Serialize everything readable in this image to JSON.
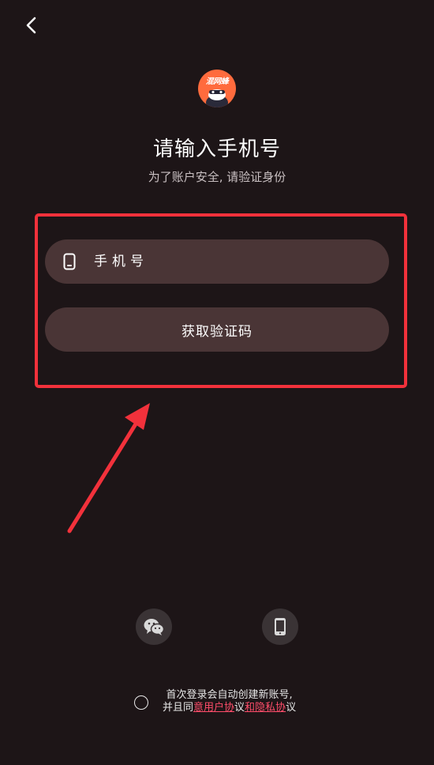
{
  "header": {
    "back_icon": "chevron-left-icon"
  },
  "logo": {
    "text": "混网蜂",
    "icon": "app-logo"
  },
  "title": "请输入手机号",
  "subtitle": "为了账户安全, 请验证身份",
  "form": {
    "phone_placeholder": "手机号",
    "phone_value": "",
    "phone_icon": "phone-outline-icon",
    "get_code_label": "获取验证码"
  },
  "social": {
    "wechat_icon": "wechat-icon",
    "phone_login_icon": "mobile-phone-icon"
  },
  "agreement": {
    "line1": "首次登录会自动创建新账号,",
    "prefix": "并且同",
    "user_link": "意用户协",
    "middle": "议",
    "privacy_link": "和隐私协",
    "suffix": "议"
  },
  "colors": {
    "background": "#1d1517",
    "field_bg": "#4a3536",
    "highlight": "#f2313b",
    "link": "#ff4d6a",
    "logo_bg": "#ff6b3d"
  }
}
